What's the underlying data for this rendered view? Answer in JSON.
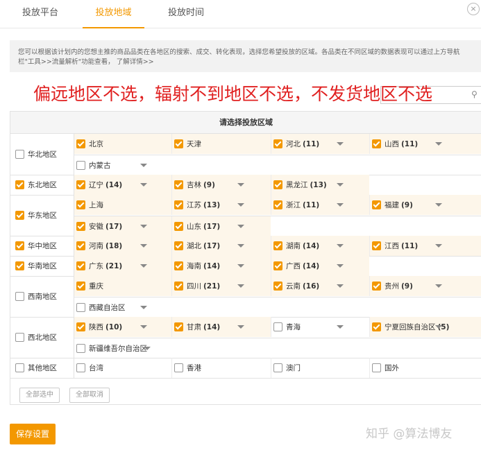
{
  "tabs": [
    {
      "label": "投放平台",
      "active": false
    },
    {
      "label": "投放地域",
      "active": true
    },
    {
      "label": "投放时间",
      "active": false
    }
  ],
  "close_icon": "×",
  "notice": {
    "text": "您可以根据该计划内的您想主推的商品品类在各地区的搜索、成交、转化表现，选择您希望投放的区域。各品类在不同区域的数据表现可以通过上方导航栏\"工具>>流量解析\"功能查看，",
    "link": "了解详情>>"
  },
  "annotation_text": "偏远地区不选，辐射不到地区不选，不发货地区不选",
  "search": {
    "placeholder": "",
    "icon": "search-icon"
  },
  "panel_title": "请选择投放区域",
  "regions": [
    {
      "label": "华北地区",
      "checked": false,
      "provinces": [
        [
          {
            "name": "北京",
            "checked": true,
            "count": "",
            "arrow": false
          },
          {
            "name": "天津",
            "checked": true,
            "count": "",
            "arrow": false
          },
          {
            "name": "河北",
            "checked": true,
            "count": "(11)",
            "arrow": true
          },
          {
            "name": "山西",
            "checked": true,
            "count": "(11)",
            "arrow": true
          }
        ],
        [
          {
            "name": "内蒙古",
            "checked": false,
            "count": "",
            "arrow": true
          }
        ]
      ]
    },
    {
      "label": "东北地区",
      "checked": true,
      "provinces": [
        [
          {
            "name": "辽宁",
            "checked": true,
            "count": "(14)",
            "arrow": true
          },
          {
            "name": "吉林",
            "checked": true,
            "count": "(9)",
            "arrow": true
          },
          {
            "name": "黑龙江",
            "checked": true,
            "count": "(13)",
            "arrow": true
          }
        ]
      ]
    },
    {
      "label": "华东地区",
      "checked": true,
      "provinces": [
        [
          {
            "name": "上海",
            "checked": true,
            "count": "",
            "arrow": false
          },
          {
            "name": "江苏",
            "checked": true,
            "count": "(13)",
            "arrow": true
          },
          {
            "name": "浙江",
            "checked": true,
            "count": "(11)",
            "arrow": true
          },
          {
            "name": "福建",
            "checked": true,
            "count": "(9)",
            "arrow": true
          }
        ],
        [
          {
            "name": "安徽",
            "checked": true,
            "count": "(17)",
            "arrow": true
          },
          {
            "name": "山东",
            "checked": true,
            "count": "(17)",
            "arrow": true
          }
        ]
      ]
    },
    {
      "label": "华中地区",
      "checked": true,
      "provinces": [
        [
          {
            "name": "河南",
            "checked": true,
            "count": "(18)",
            "arrow": true
          },
          {
            "name": "湖北",
            "checked": true,
            "count": "(17)",
            "arrow": true
          },
          {
            "name": "湖南",
            "checked": true,
            "count": "(14)",
            "arrow": true
          },
          {
            "name": "江西",
            "checked": true,
            "count": "(11)",
            "arrow": true
          }
        ]
      ]
    },
    {
      "label": "华南地区",
      "checked": true,
      "provinces": [
        [
          {
            "name": "广东",
            "checked": true,
            "count": "(21)",
            "arrow": true
          },
          {
            "name": "海南",
            "checked": true,
            "count": "(14)",
            "arrow": true
          },
          {
            "name": "广西",
            "checked": true,
            "count": "(14)",
            "arrow": true
          }
        ]
      ]
    },
    {
      "label": "西南地区",
      "checked": false,
      "provinces": [
        [
          {
            "name": "重庆",
            "checked": true,
            "count": "",
            "arrow": false
          },
          {
            "name": "四川",
            "checked": true,
            "count": "(21)",
            "arrow": true
          },
          {
            "name": "云南",
            "checked": true,
            "count": "(16)",
            "arrow": true
          },
          {
            "name": "贵州",
            "checked": true,
            "count": "(9)",
            "arrow": true
          }
        ],
        [
          {
            "name": "西藏自治区",
            "checked": false,
            "count": "",
            "arrow": true
          }
        ]
      ]
    },
    {
      "label": "西北地区",
      "checked": false,
      "provinces": [
        [
          {
            "name": "陕西",
            "checked": true,
            "count": "(10)",
            "arrow": true
          },
          {
            "name": "甘肃",
            "checked": true,
            "count": "(14)",
            "arrow": true
          },
          {
            "name": "青海",
            "checked": false,
            "count": "",
            "arrow": true
          },
          {
            "name": "宁夏回族自治区",
            "checked": true,
            "count": "(5)",
            "arrow": true
          }
        ],
        [
          {
            "name": "新疆维吾尔自治区",
            "checked": false,
            "count": "",
            "arrow": true
          }
        ]
      ]
    },
    {
      "label": "其他地区",
      "checked": false,
      "provinces": [
        [
          {
            "name": "台湾",
            "checked": false,
            "count": "",
            "arrow": false
          },
          {
            "name": "香港",
            "checked": false,
            "count": "",
            "arrow": false
          },
          {
            "name": "澳门",
            "checked": false,
            "count": "",
            "arrow": false
          },
          {
            "name": "国外",
            "checked": false,
            "count": "",
            "arrow": false
          }
        ]
      ]
    }
  ],
  "buttons": {
    "select_all": "全部选中",
    "cancel_all": "全部取消",
    "save": "保存设置"
  },
  "watermark": "知乎 @算法博友",
  "colors": {
    "accent": "#f39800",
    "annotation": "#e02020"
  }
}
